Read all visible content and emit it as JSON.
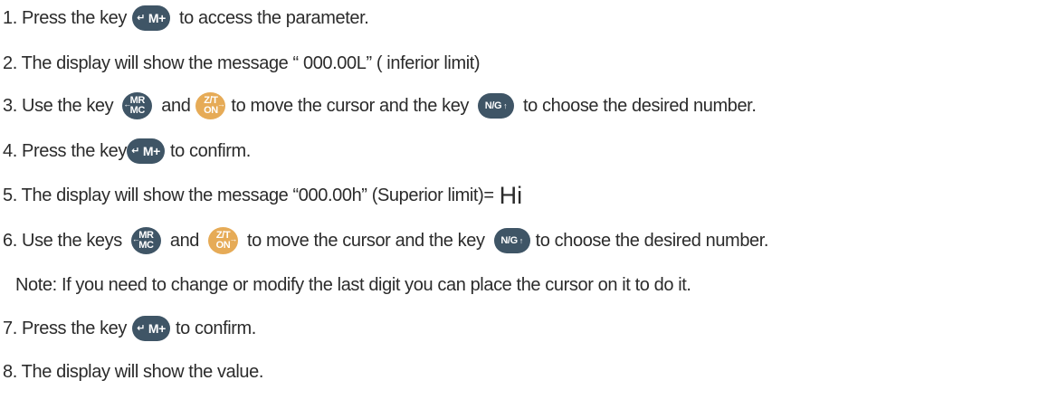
{
  "steps": {
    "s1": {
      "before": "1. Press the key",
      "after": "to access the parameter."
    },
    "s2": {
      "text": "2. The display will show the message “ 000.00L” ( inferior limit)"
    },
    "s3": {
      "before": "3. Use the key",
      "and": "and",
      "middle": "to move the cursor and the key",
      "after": "to choose the desired number."
    },
    "s4": {
      "before": "4. Press the key",
      "after": "to confirm."
    },
    "s5": {
      "text": "5. The display will show the message “000.00h”  (Superior limit)=",
      "emphasis": "Hi"
    },
    "s6": {
      "before": "6. Use the keys",
      "and": "and",
      "middle": "to move the cursor and the key",
      "after": "to choose the desired number."
    },
    "note": {
      "text": "Note: If you need to change or modify the last digit you can place the cursor on it to do it."
    },
    "s7": {
      "before": "7. Press the key",
      "after": "to confirm."
    },
    "s8": {
      "text": "8. The display will show the value."
    }
  },
  "keys": {
    "mplus": {
      "arrow": "↵",
      "label": "M+"
    },
    "mrmc": {
      "top": "MR",
      "bottom": "MC",
      "arrow": "←"
    },
    "ztoN": {
      "top": "Z/T",
      "bottom": "ON",
      "arrow": "→"
    },
    "ng": {
      "label": "N/G",
      "arrow": "↑"
    }
  },
  "colors": {
    "key_dark": "#3f5566",
    "key_orange": "#e6ab57",
    "text": "#2b2b2b"
  }
}
